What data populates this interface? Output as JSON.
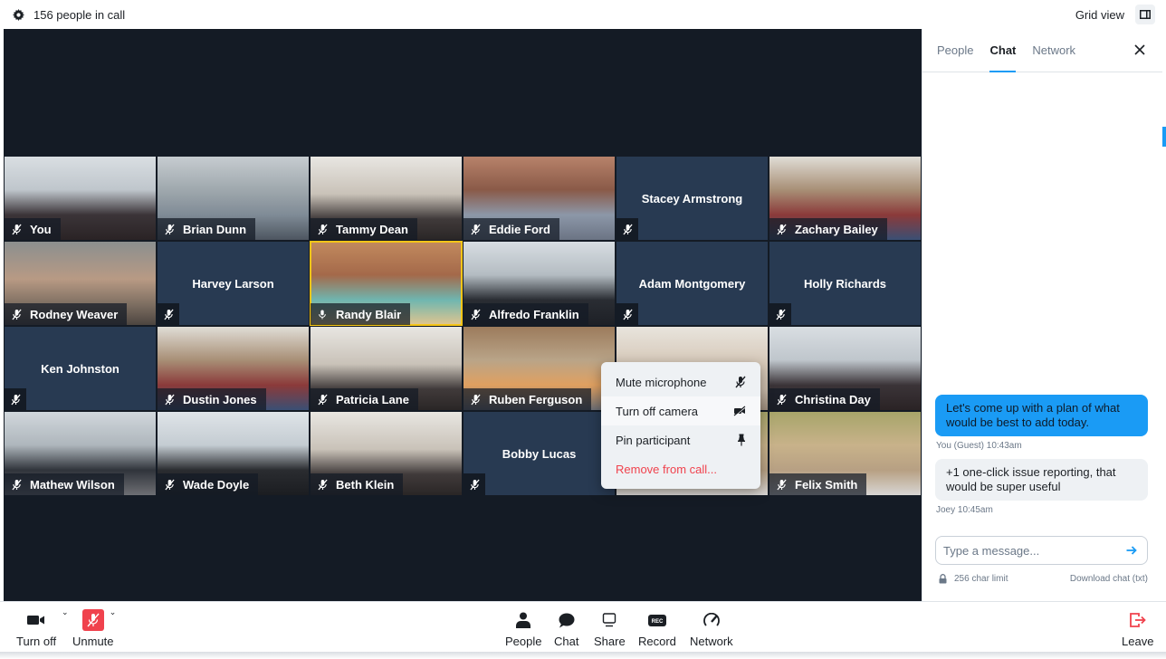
{
  "topbar": {
    "participants_text": "156 people in call",
    "view_label": "Grid view",
    "view_modes": [
      {
        "name": "sidebar-view",
        "active": false
      },
      {
        "name": "grid-view",
        "active": true
      }
    ]
  },
  "participants": [
    {
      "name": "You",
      "video": true,
      "mic": "muted",
      "bg": "ph1"
    },
    {
      "name": "Brian Dunn",
      "video": true,
      "mic": "muted",
      "bg": "ph2"
    },
    {
      "name": "Tammy Dean",
      "video": true,
      "mic": "muted",
      "bg": "ph3"
    },
    {
      "name": "Eddie Ford",
      "video": true,
      "mic": "muted",
      "bg": "ph4"
    },
    {
      "name": "Stacey Armstrong",
      "video": false,
      "mic": "muted"
    },
    {
      "name": "Zachary Bailey",
      "video": true,
      "mic": "muted",
      "bg": "ph5"
    },
    {
      "name": "Rodney Weaver",
      "video": true,
      "mic": "muted",
      "bg": "ph6"
    },
    {
      "name": "Harvey Larson",
      "video": false,
      "mic": "muted"
    },
    {
      "name": "Randy Blair",
      "video": true,
      "mic": "on",
      "active_speaker": true,
      "bg": "ph7"
    },
    {
      "name": "Alfredo Franklin",
      "video": true,
      "mic": "muted",
      "bg": "ph8"
    },
    {
      "name": "Adam Montgomery",
      "video": false,
      "mic": "muted"
    },
    {
      "name": "Holly Richards",
      "video": false,
      "mic": "muted"
    },
    {
      "name": "Ken Johnston",
      "video": false,
      "mic": "muted"
    },
    {
      "name": "Dustin Jones",
      "video": true,
      "mic": "muted",
      "bg": "ph5"
    },
    {
      "name": "Patricia Lane",
      "video": true,
      "mic": "muted",
      "bg": "ph3"
    },
    {
      "name": "Ruben Ferguson",
      "video": true,
      "mic": "muted",
      "bg": "ph9"
    },
    {
      "name": "",
      "video": true,
      "mic": "muted",
      "bg": "ph10"
    },
    {
      "name": "Christina Day",
      "video": true,
      "mic": "muted",
      "bg": "ph1"
    },
    {
      "name": "Mathew Wilson",
      "video": true,
      "mic": "muted",
      "bg": "ph12"
    },
    {
      "name": "Wade Doyle",
      "video": true,
      "mic": "muted",
      "bg": "ph13"
    },
    {
      "name": "Beth Klein",
      "video": true,
      "mic": "muted",
      "bg": "ph3"
    },
    {
      "name": "Bobby Lucas",
      "video": false,
      "mic": "muted"
    },
    {
      "name": "",
      "video": true,
      "mic": "muted",
      "bg": "ph11"
    },
    {
      "name": "Felix Smith",
      "video": true,
      "mic": "muted",
      "bg": "ph11"
    }
  ],
  "context_menu": {
    "items": [
      {
        "label": "Mute microphone",
        "icon": "mic-off-icon"
      },
      {
        "label": "Turn off camera",
        "icon": "camera-off-icon"
      },
      {
        "label": "Pin participant",
        "icon": "pin-icon"
      },
      {
        "label": "Remove from call...",
        "danger": true
      }
    ]
  },
  "panel": {
    "tabs": [
      {
        "label": "People",
        "active": false
      },
      {
        "label": "Chat",
        "active": true
      },
      {
        "label": "Network",
        "active": false
      }
    ],
    "messages": [
      {
        "text": "Let's come up with a plan of what would be best to add today.",
        "meta": "You (Guest) 10:43am",
        "mine": true
      },
      {
        "text": "+1 one-click issue reporting, that would be super useful",
        "meta": "Joey 10:45am",
        "mine": false
      }
    ],
    "composer": {
      "placeholder": "Type a message...",
      "value": "",
      "char_limit": "256 char limit",
      "download_label": "Download chat (txt)"
    }
  },
  "bottombar": {
    "camera_label": "Turn off",
    "mic_label": "Unmute",
    "center": [
      {
        "label": "People",
        "icon": "person-icon"
      },
      {
        "label": "Chat",
        "icon": "chat-bubble-icon"
      },
      {
        "label": "Share",
        "icon": "screen-share-icon"
      },
      {
        "label": "Record",
        "icon": "record-icon"
      },
      {
        "label": "Network",
        "icon": "gauge-icon"
      }
    ],
    "record_badge": "REC",
    "leave_label": "Leave"
  },
  "colors": {
    "accent": "#1a9bf5",
    "danger": "#f0424d",
    "stage_bg": "#141b25",
    "tile_bg": "#283a52",
    "active_speaker": "#f5c518"
  }
}
